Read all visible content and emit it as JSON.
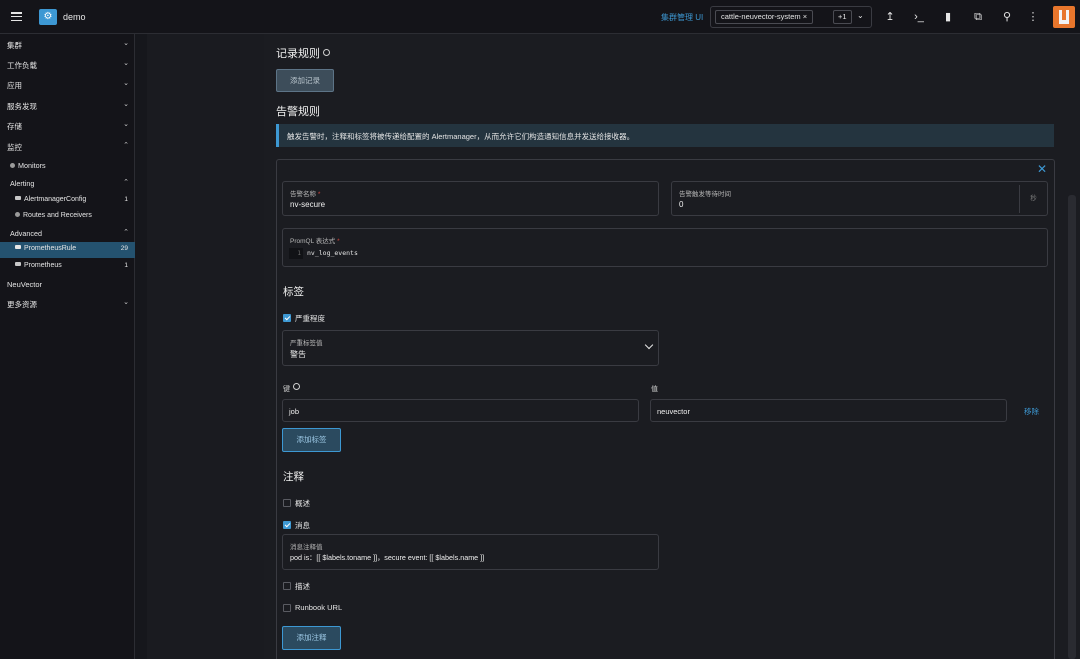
{
  "header": {
    "cluster_name": "demo",
    "mgmt_link": "集群管理 UI",
    "namespace_chip": "cattle-neuvector-system ×",
    "namespace_more": "+1"
  },
  "sidebar": {
    "items": [
      {
        "label": "集群"
      },
      {
        "label": "工作负载"
      },
      {
        "label": "应用"
      },
      {
        "label": "服务发现"
      },
      {
        "label": "存储"
      },
      {
        "label": "监控"
      },
      {
        "label": "Monitors"
      },
      {
        "label": "Alerting"
      },
      {
        "label": "AlertmanagerConfig",
        "count": "1"
      },
      {
        "label": "Routes and Receivers"
      },
      {
        "label": "Advanced"
      },
      {
        "label": "PrometheusRule",
        "count": "29"
      },
      {
        "label": "Prometheus",
        "count": "1"
      },
      {
        "label": "NeuVector"
      },
      {
        "label": "更多资源"
      }
    ]
  },
  "main": {
    "record_rules_title": "记录规则",
    "add_record_label": "添加记录",
    "alert_rules_title": "告警规则",
    "banner_text": "触发告警时，注释和标签将被传递给配置的 Alertmanager，从而允许它们构造通知信息并发送给接收器。",
    "alert_name": {
      "label": "告警名称",
      "value": "nv-secure"
    },
    "wait_time": {
      "label": "告警触发等待时间",
      "value": "0",
      "suffix": "秒"
    },
    "promql": {
      "label": "PromQL 表达式",
      "line_no": "1",
      "code": "nv_log_events"
    },
    "labels_title": "标签",
    "severity_checkbox": "严重程度",
    "severity_select": {
      "label": "严重标签值",
      "value": "警告"
    },
    "key_label": "键",
    "value_label": "值",
    "label_row": {
      "key": "job",
      "value": "neuvector",
      "remove": "移除"
    },
    "add_label_btn": "添加标签",
    "annotations_title": "注释",
    "summary_checkbox": "概述",
    "message_checkbox": "消息",
    "message_field": {
      "label": "消息注释值",
      "value": "pod is：[[ $labels.toname ]]，secure event: [[ $labels.name ]]"
    },
    "description_checkbox": "描述",
    "runbook_checkbox": "Runbook URL",
    "add_annotation_btn": "添加注释"
  },
  "colors": {
    "accent": "#3d98d3",
    "background": "#1b1c21",
    "sidebar_active": "#24526f"
  }
}
